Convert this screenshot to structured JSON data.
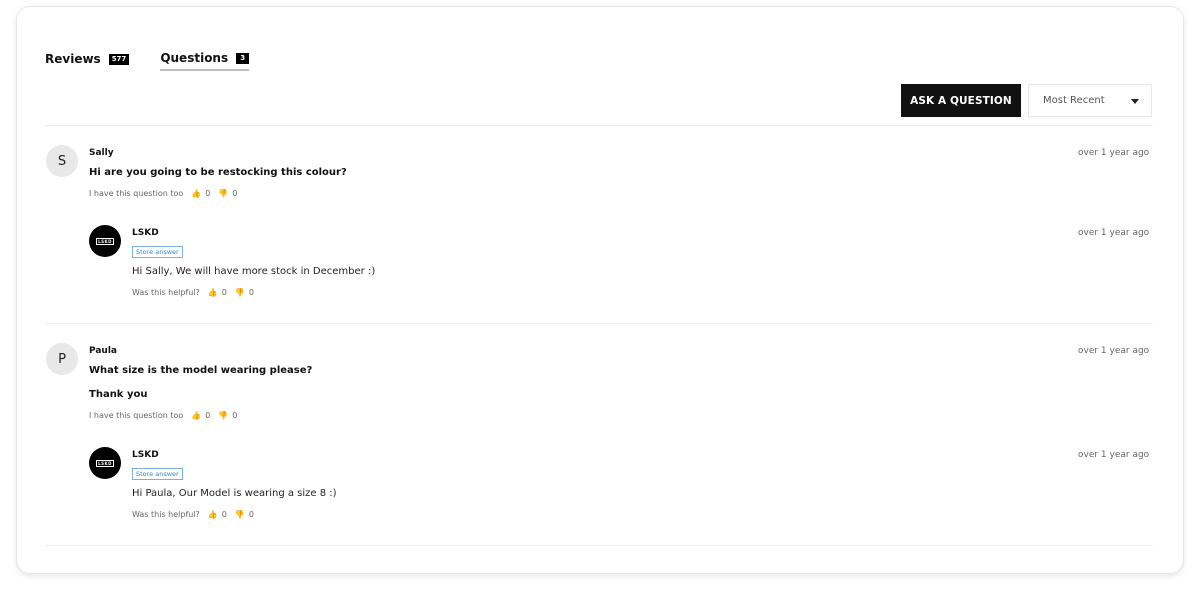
{
  "tabs": [
    {
      "label": "Reviews",
      "count": "577"
    },
    {
      "label": "Questions",
      "count": "3"
    }
  ],
  "toolbar": {
    "ask_label": "ASK A QUESTION",
    "sort_value": "Most Recent"
  },
  "questions": [
    {
      "avatar": "S",
      "author": "Sally",
      "time": "over 1 year ago",
      "text": "Hi are you going to be restocking this colour?",
      "meta_label": "I have this question too",
      "up": "0",
      "down": "0",
      "answer": {
        "logo": "LSKD",
        "author": "LSKD",
        "badge": "Store answer",
        "time": "over 1 year ago",
        "text": "Hi Sally, We will have more stock in December :)",
        "meta_label": "Was this helpful?",
        "up": "0",
        "down": "0"
      }
    },
    {
      "avatar": "P",
      "author": "Paula",
      "time": "over 1 year ago",
      "text": "What size is the model wearing please?",
      "text2": "Thank you",
      "meta_label": "I have this question too",
      "up": "0",
      "down": "0",
      "answer": {
        "logo": "LSKD",
        "author": "LSKD",
        "badge": "Store answer",
        "time": "over 1 year ago",
        "text": "Hi Paula, Our Model is wearing a size 8 :)",
        "meta_label": "Was this helpful?",
        "up": "0",
        "down": "0"
      }
    }
  ]
}
